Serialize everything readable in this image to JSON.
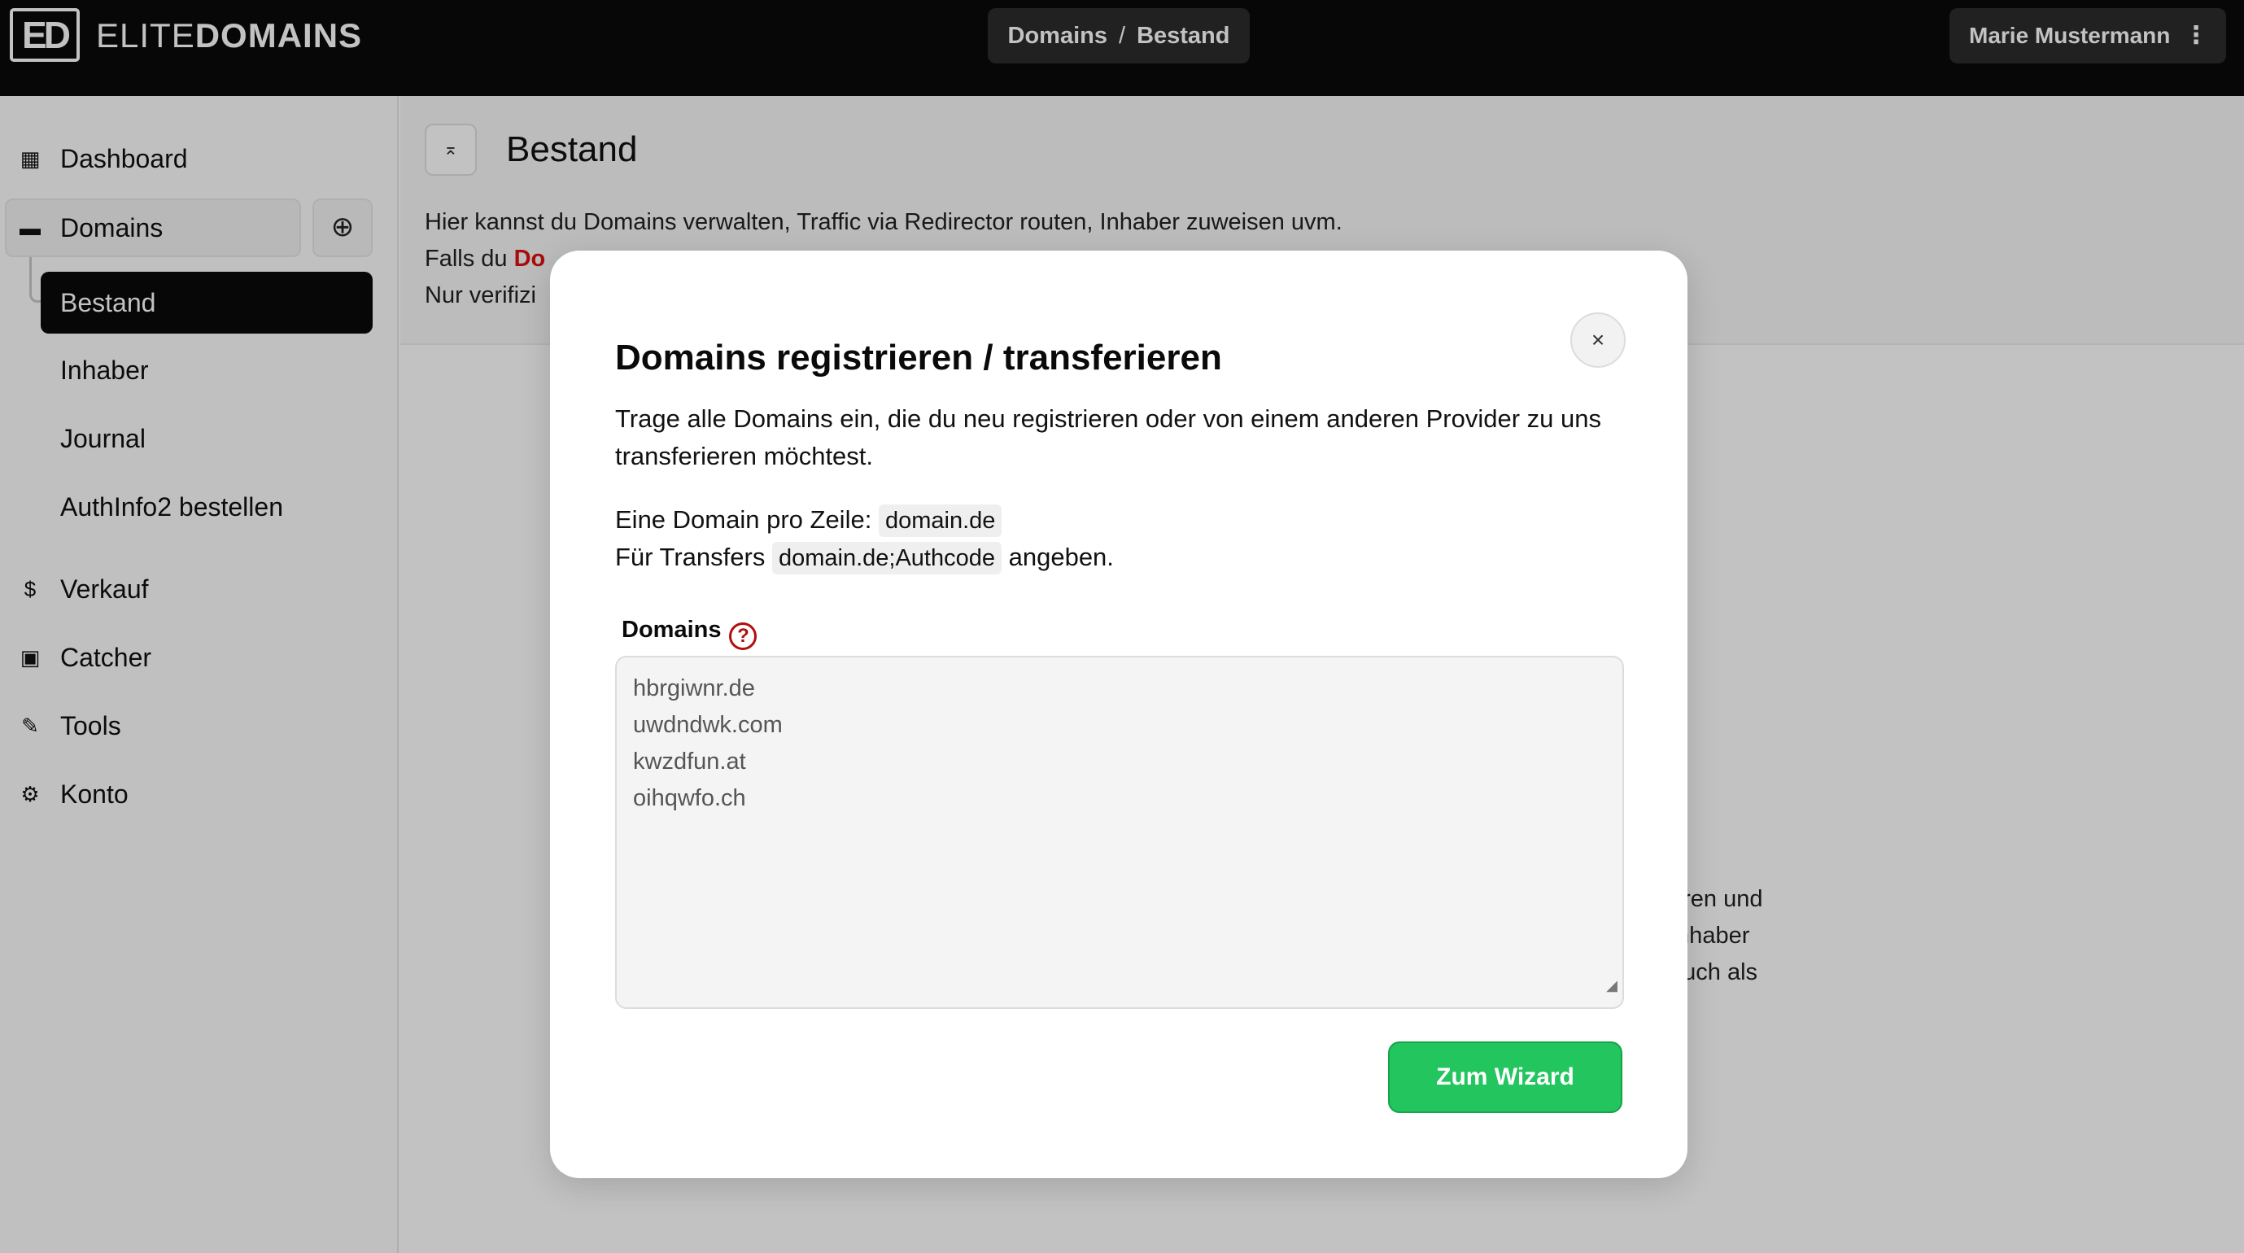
{
  "topbar": {
    "logo_mark": "ED",
    "brand_part1": "ELITE",
    "brand_part2": "DOMAINS",
    "breadcrumb": [
      "Domains",
      "Bestand"
    ],
    "breadcrumb_sep": "/",
    "user_name": "Marie Mustermann",
    "user_menu_icon": "more-vertical-icon"
  },
  "sidebar": {
    "items": [
      {
        "label": "Dashboard",
        "icon": "dashboard-icon"
      },
      {
        "label": "Domains",
        "icon": "folder-icon"
      },
      {
        "label": "Verkauf",
        "icon": "dollar-icon"
      },
      {
        "label": "Catcher",
        "icon": "catcher-icon"
      },
      {
        "label": "Tools",
        "icon": "wrench-icon"
      },
      {
        "label": "Konto",
        "icon": "gear-icon"
      }
    ],
    "domains_add_icon": "plus-circle-icon",
    "subitems": [
      "Bestand",
      "Inhaber",
      "Journal",
      "AuthInfo2 bestellen"
    ]
  },
  "main": {
    "title": "Bestand",
    "desc_line1": "Hier kannst du Domains verwalten, Traffic via Redirector routen, Inhaber zuweisen uvm.",
    "desc_line2_prefix": "Falls du ",
    "desc_line2_red": "Do",
    "desc_line3": "Nur verifizi",
    "bg_text_lines": [
      "eren und",
      "Inhaber",
      "auch als"
    ]
  },
  "modal": {
    "title": "Domains registrieren / transferieren",
    "intro_line1": "Trage alle Domains ein, die du neu registrieren oder von einem anderen Provider zu uns",
    "intro_line2": "transferieren möchtest.",
    "per_line_label": "Eine Domain pro Zeile:",
    "per_line_code": "domain.de",
    "transfer_prefix": "Für Transfers",
    "transfer_code": "domain.de;Authcode",
    "transfer_suffix": "angeben.",
    "field_label": "Domains",
    "domains": [
      "hbrgiwnr.de",
      "uwdndwk.com",
      "kwzdfun.at",
      "oihqwfo.ch"
    ],
    "submit_label": "Zum Wizard",
    "close_symbol": "×"
  }
}
